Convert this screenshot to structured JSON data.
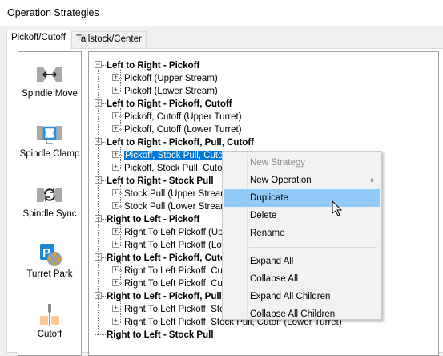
{
  "window": {
    "title": "Operation Strategies"
  },
  "tabs": [
    {
      "label": "Pickoff/Cutoff",
      "active": true
    },
    {
      "label": "Tailstock/Center",
      "active": false
    }
  ],
  "palette": [
    {
      "label": "Spindle Move",
      "icon": "spindle-move-icon"
    },
    {
      "label": "Spindle Clamp",
      "icon": "spindle-clamp-icon"
    },
    {
      "label": "Spindle Sync",
      "icon": "spindle-sync-icon"
    },
    {
      "label": "Turret Park",
      "icon": "turret-park-icon"
    },
    {
      "label": "Cutoff",
      "icon": "cutoff-icon"
    }
  ],
  "tree": [
    {
      "label": "Left to Right - Pickoff",
      "children": [
        "Pickoff (Upper Stream)",
        "Pickoff (Lower Stream)"
      ]
    },
    {
      "label": "Left to Right - Pickoff, Cutoff",
      "children": [
        "Pickoff, Cutoff (Upper Turret)",
        "Pickoff, Cutoff (Lower Turret)"
      ]
    },
    {
      "label": "Left to Right - Pickoff, Pull, Cutoff",
      "children": [
        "Pickoff, Stock Pull, Cutoff (Upper Turret)",
        "Pickoff, Stock Pull, Cutoff (Lower Turret)"
      ]
    },
    {
      "label": "Left to Right - Stock Pull",
      "children": [
        "Stock Pull (Upper Stream)",
        "Stock Pull (Lower Stream)"
      ]
    },
    {
      "label": "Right to Left - Pickoff",
      "children": [
        "Right To Left Pickoff (Upper Stream)",
        "Right To Left Pickoff (Lower Stream)"
      ]
    },
    {
      "label": "Right to Left - Pickoff, Cutoff",
      "children": [
        "Right To Left Pickoff, Cutoff (Upper Turret)",
        "Right To Left Pickoff, Cutoff (Lower Turret)"
      ]
    },
    {
      "label": "Right to Left - Pickoff, Pull, Cutoff",
      "children": [
        "Right To Left Pickoff, Stock Pull, Cutoff (Upper Turret)",
        "Right To Left Pickoff, Stock Pull, Cutoff (Lower Turret)"
      ]
    },
    {
      "label": "Right to Left - Stock Pull",
      "children": []
    }
  ],
  "selected": "Pickoff, Stock Pull, Cutoff (Upper Turret)",
  "context_menu": {
    "items": [
      {
        "label": "New Strategy",
        "disabled": true
      },
      {
        "label": "New Operation",
        "submenu": true
      },
      {
        "label": "Duplicate",
        "highlighted": true
      },
      {
        "label": "Delete"
      },
      {
        "label": "Rename"
      },
      {
        "separator": true
      },
      {
        "label": "Expand All"
      },
      {
        "label": "Collapse All"
      },
      {
        "label": "Expand All Children"
      },
      {
        "label": "Collapse All Children"
      }
    ],
    "submenu_arrow": "›"
  }
}
